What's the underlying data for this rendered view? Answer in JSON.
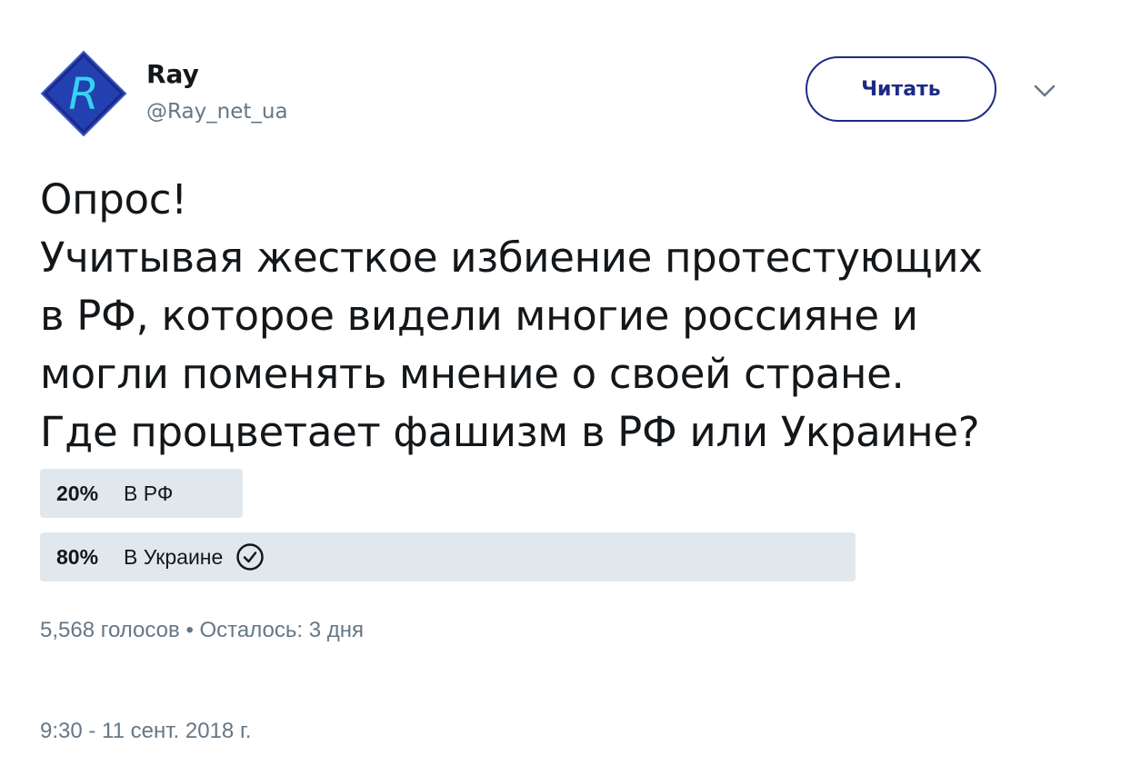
{
  "author": {
    "avatar_letter": "R",
    "display_name": "Ray",
    "handle": "@Ray_net_ua",
    "avatar_colors": {
      "outer": "#1a2a8c",
      "inner": "#2340b0",
      "letter": "#35d3f2"
    }
  },
  "follow_button": {
    "label": "Читать",
    "color": "#1c2a86"
  },
  "menu": {
    "icon": "chevron-down-icon"
  },
  "tweet": {
    "text": "Опрос!\nУчитывая жесткое избиение протестующих\nв РФ, которое видели многие россияне и\nмогли поменять мнение о своей стране.\nГде процветает фашизм в РФ или Украине?"
  },
  "poll": {
    "options": [
      {
        "percent_label": "20%",
        "label": "В РФ",
        "share": 0.2,
        "selected": false
      },
      {
        "percent_label": "80%",
        "label": "В Украине",
        "share": 0.8,
        "selected": true
      }
    ],
    "votes": "5,568 голосов",
    "separator": "•",
    "time_left": "Осталось: 3 дня",
    "bar_color": "#e1e8ed",
    "check_icon": "check-circle-icon"
  },
  "timestamp": "9:30 - 11 сент. 2018 г."
}
